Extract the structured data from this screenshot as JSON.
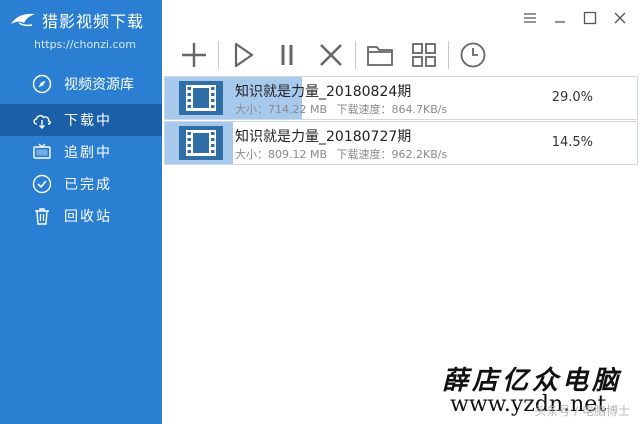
{
  "app": {
    "title": "猎影视频下载",
    "url": "https://chonzi.com"
  },
  "sidebar": {
    "items": [
      {
        "label": "视频资源库",
        "icon": "compass-icon",
        "active": false
      },
      {
        "label": "下载中",
        "icon": "cloud-download-icon",
        "active": true
      },
      {
        "label": "追剧中",
        "icon": "tv-icon",
        "active": false
      },
      {
        "label": "已完成",
        "icon": "check-circle-icon",
        "active": false
      },
      {
        "label": "回收站",
        "icon": "trash-icon",
        "active": false
      }
    ]
  },
  "window_controls": [
    "menu-icon",
    "minimize-icon",
    "maximize-icon",
    "close-icon"
  ],
  "toolbar": [
    "add-icon",
    "play-icon",
    "pause-icon",
    "delete-icon",
    "folder-icon",
    "grid-icon",
    "clock-icon"
  ],
  "tasks": [
    {
      "name": "知识就是力量_20180824期",
      "size_label": "大小：",
      "size": "714.22 MB",
      "speed_label": "下载速度：",
      "speed": "864.7KB/s",
      "percent": "29.0%",
      "progress": 0.29
    },
    {
      "name": "知识就是力量_20180727期",
      "size_label": "大小：",
      "size": "809.12 MB",
      "speed_label": "下载速度：",
      "speed": "962.2KB/s",
      "percent": "14.5%",
      "progress": 0.145
    }
  ],
  "watermark": {
    "store": "薛店亿众电脑",
    "url": "www.yzdn.net",
    "credit": "头条号 / 电脑博士"
  },
  "colors": {
    "sidebar": "#2b7fd2",
    "sidebar_active": "#1b5fa8",
    "progress": "#a8c9ee",
    "thumb": "#2f6fa6"
  }
}
